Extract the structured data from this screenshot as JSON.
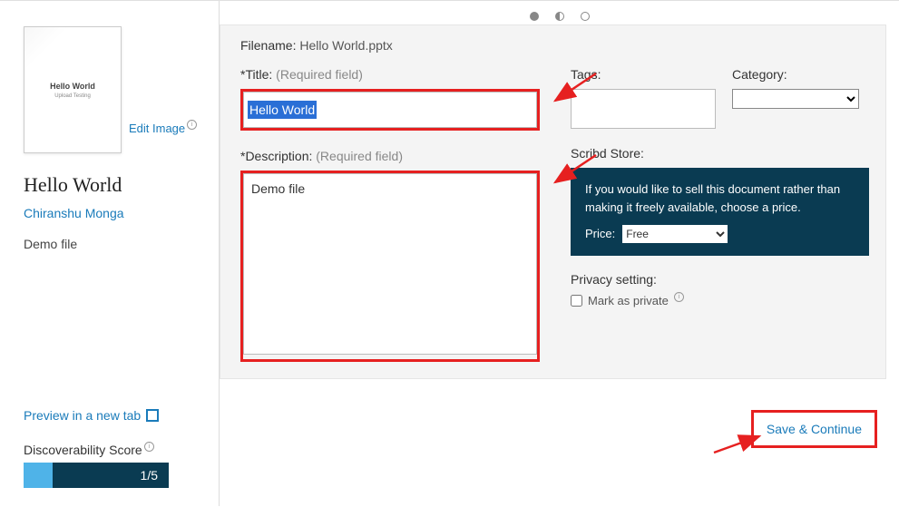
{
  "sidebar": {
    "thumb_title": "Hello World",
    "thumb_sub": "Upload Testing",
    "edit_image": "Edit Image",
    "doc_title": "Hello World",
    "author": "Chiranshu Monga",
    "desc_short": "Demo file",
    "preview_tab": "Preview in a new tab",
    "disc_label": "Discoverability Score",
    "disc_score": "1/5"
  },
  "form": {
    "filename_label": "Filename:",
    "filename_value": "Hello World.pptx",
    "title_label": "*Title:",
    "title_hint": "(Required field)",
    "title_value": "Hello World",
    "desc_label": "*Description:",
    "desc_hint": "(Required field)",
    "desc_value": "Demo file",
    "tags_label": "Tags:",
    "category_label": "Category:",
    "store_label": "Scribd Store:",
    "store_text": "If you would like to sell this document rather than making it freely available, choose a price.",
    "price_label": "Price:",
    "price_value": "Free",
    "privacy_label": "Privacy setting:",
    "privacy_check": "Mark as private"
  },
  "footer": {
    "save_label": "Save & Continue"
  }
}
